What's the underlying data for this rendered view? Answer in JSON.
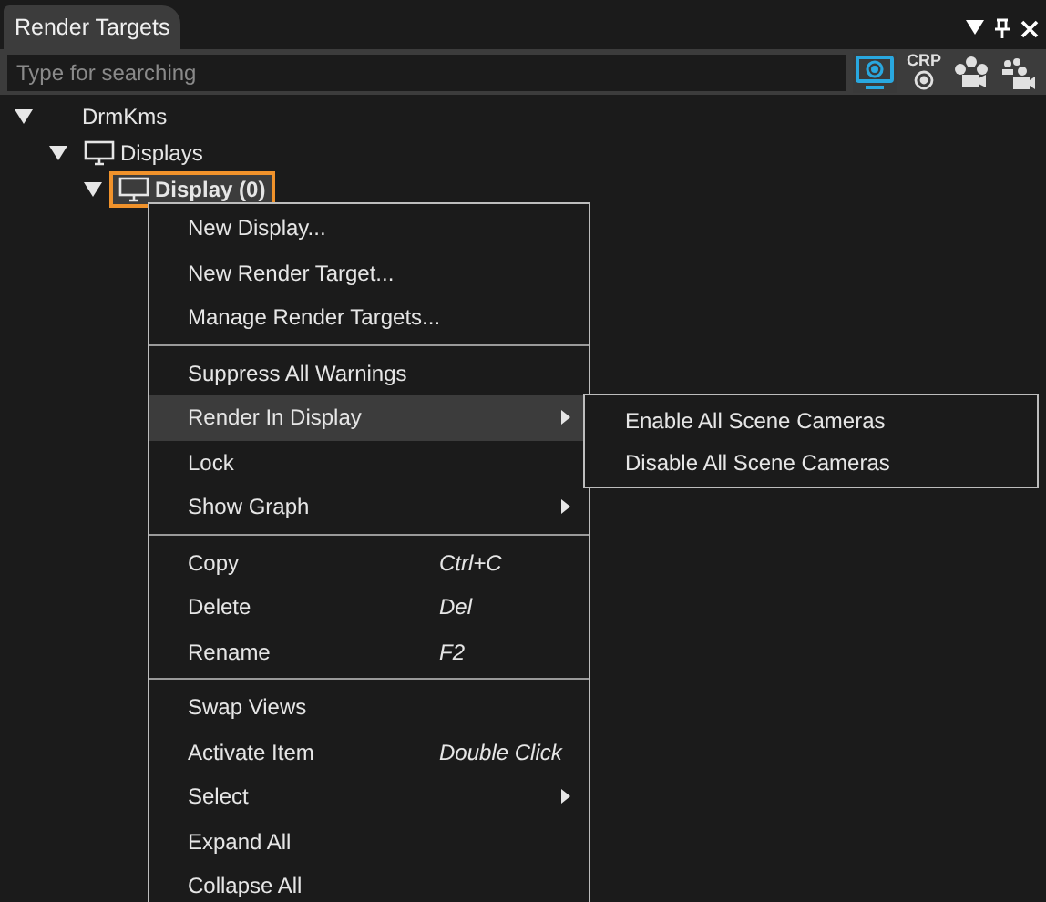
{
  "panel": {
    "title": "Render Targets"
  },
  "search": {
    "placeholder": "Type for searching"
  },
  "toolbar": [
    {
      "kind": "monitor",
      "selected": true
    },
    {
      "kind": "crp",
      "label": "CRP",
      "selected": false
    },
    {
      "kind": "numbered",
      "selected": false
    },
    {
      "kind": "group",
      "selected": false
    }
  ],
  "tree": [
    {
      "label": "DrmKms",
      "expanded": true,
      "children": [
        {
          "label": "Displays",
          "expanded": true,
          "children": [
            {
              "label": "Display (0)",
              "expanded": true,
              "selected": true
            }
          ]
        }
      ]
    }
  ],
  "context_menu": {
    "sections": [
      {
        "items": [
          {
            "label": "New Display...",
            "submenu": false,
            "selected": false
          },
          {
            "label": "New Render Target...",
            "submenu": false,
            "selected": false
          },
          {
            "label": "Manage Render Targets...",
            "submenu": false,
            "selected": false
          }
        ]
      },
      {
        "items": [
          {
            "label": "Suppress All Warnings",
            "submenu": false,
            "selected": false
          },
          {
            "label": "Render In Display",
            "submenu": true,
            "selected": true
          },
          {
            "label": "Lock",
            "submenu": false,
            "selected": false
          },
          {
            "label": "Show Graph",
            "submenu": true,
            "selected": false
          }
        ]
      },
      {
        "items": [
          {
            "label": "Copy",
            "shortcut": "Ctrl+C",
            "submenu": false,
            "selected": false
          },
          {
            "label": "Delete",
            "shortcut": "Del",
            "submenu": false,
            "selected": false
          },
          {
            "label": "Rename",
            "shortcut": "F2",
            "submenu": false,
            "selected": false
          }
        ]
      },
      {
        "items": [
          {
            "label": "Swap Views",
            "submenu": false,
            "selected": false
          },
          {
            "label": "Activate Item",
            "shortcut": "Double Click",
            "submenu": false,
            "selected": false
          },
          {
            "label": "Select",
            "submenu": true,
            "selected": false
          },
          {
            "label": "Expand All",
            "submenu": false,
            "selected": false
          },
          {
            "label": "Collapse All",
            "submenu": false,
            "selected": false
          }
        ]
      }
    ]
  },
  "submenu": {
    "items": [
      {
        "label": "Enable All Scene Cameras"
      },
      {
        "label": "Disable All Scene Cameras"
      }
    ]
  }
}
